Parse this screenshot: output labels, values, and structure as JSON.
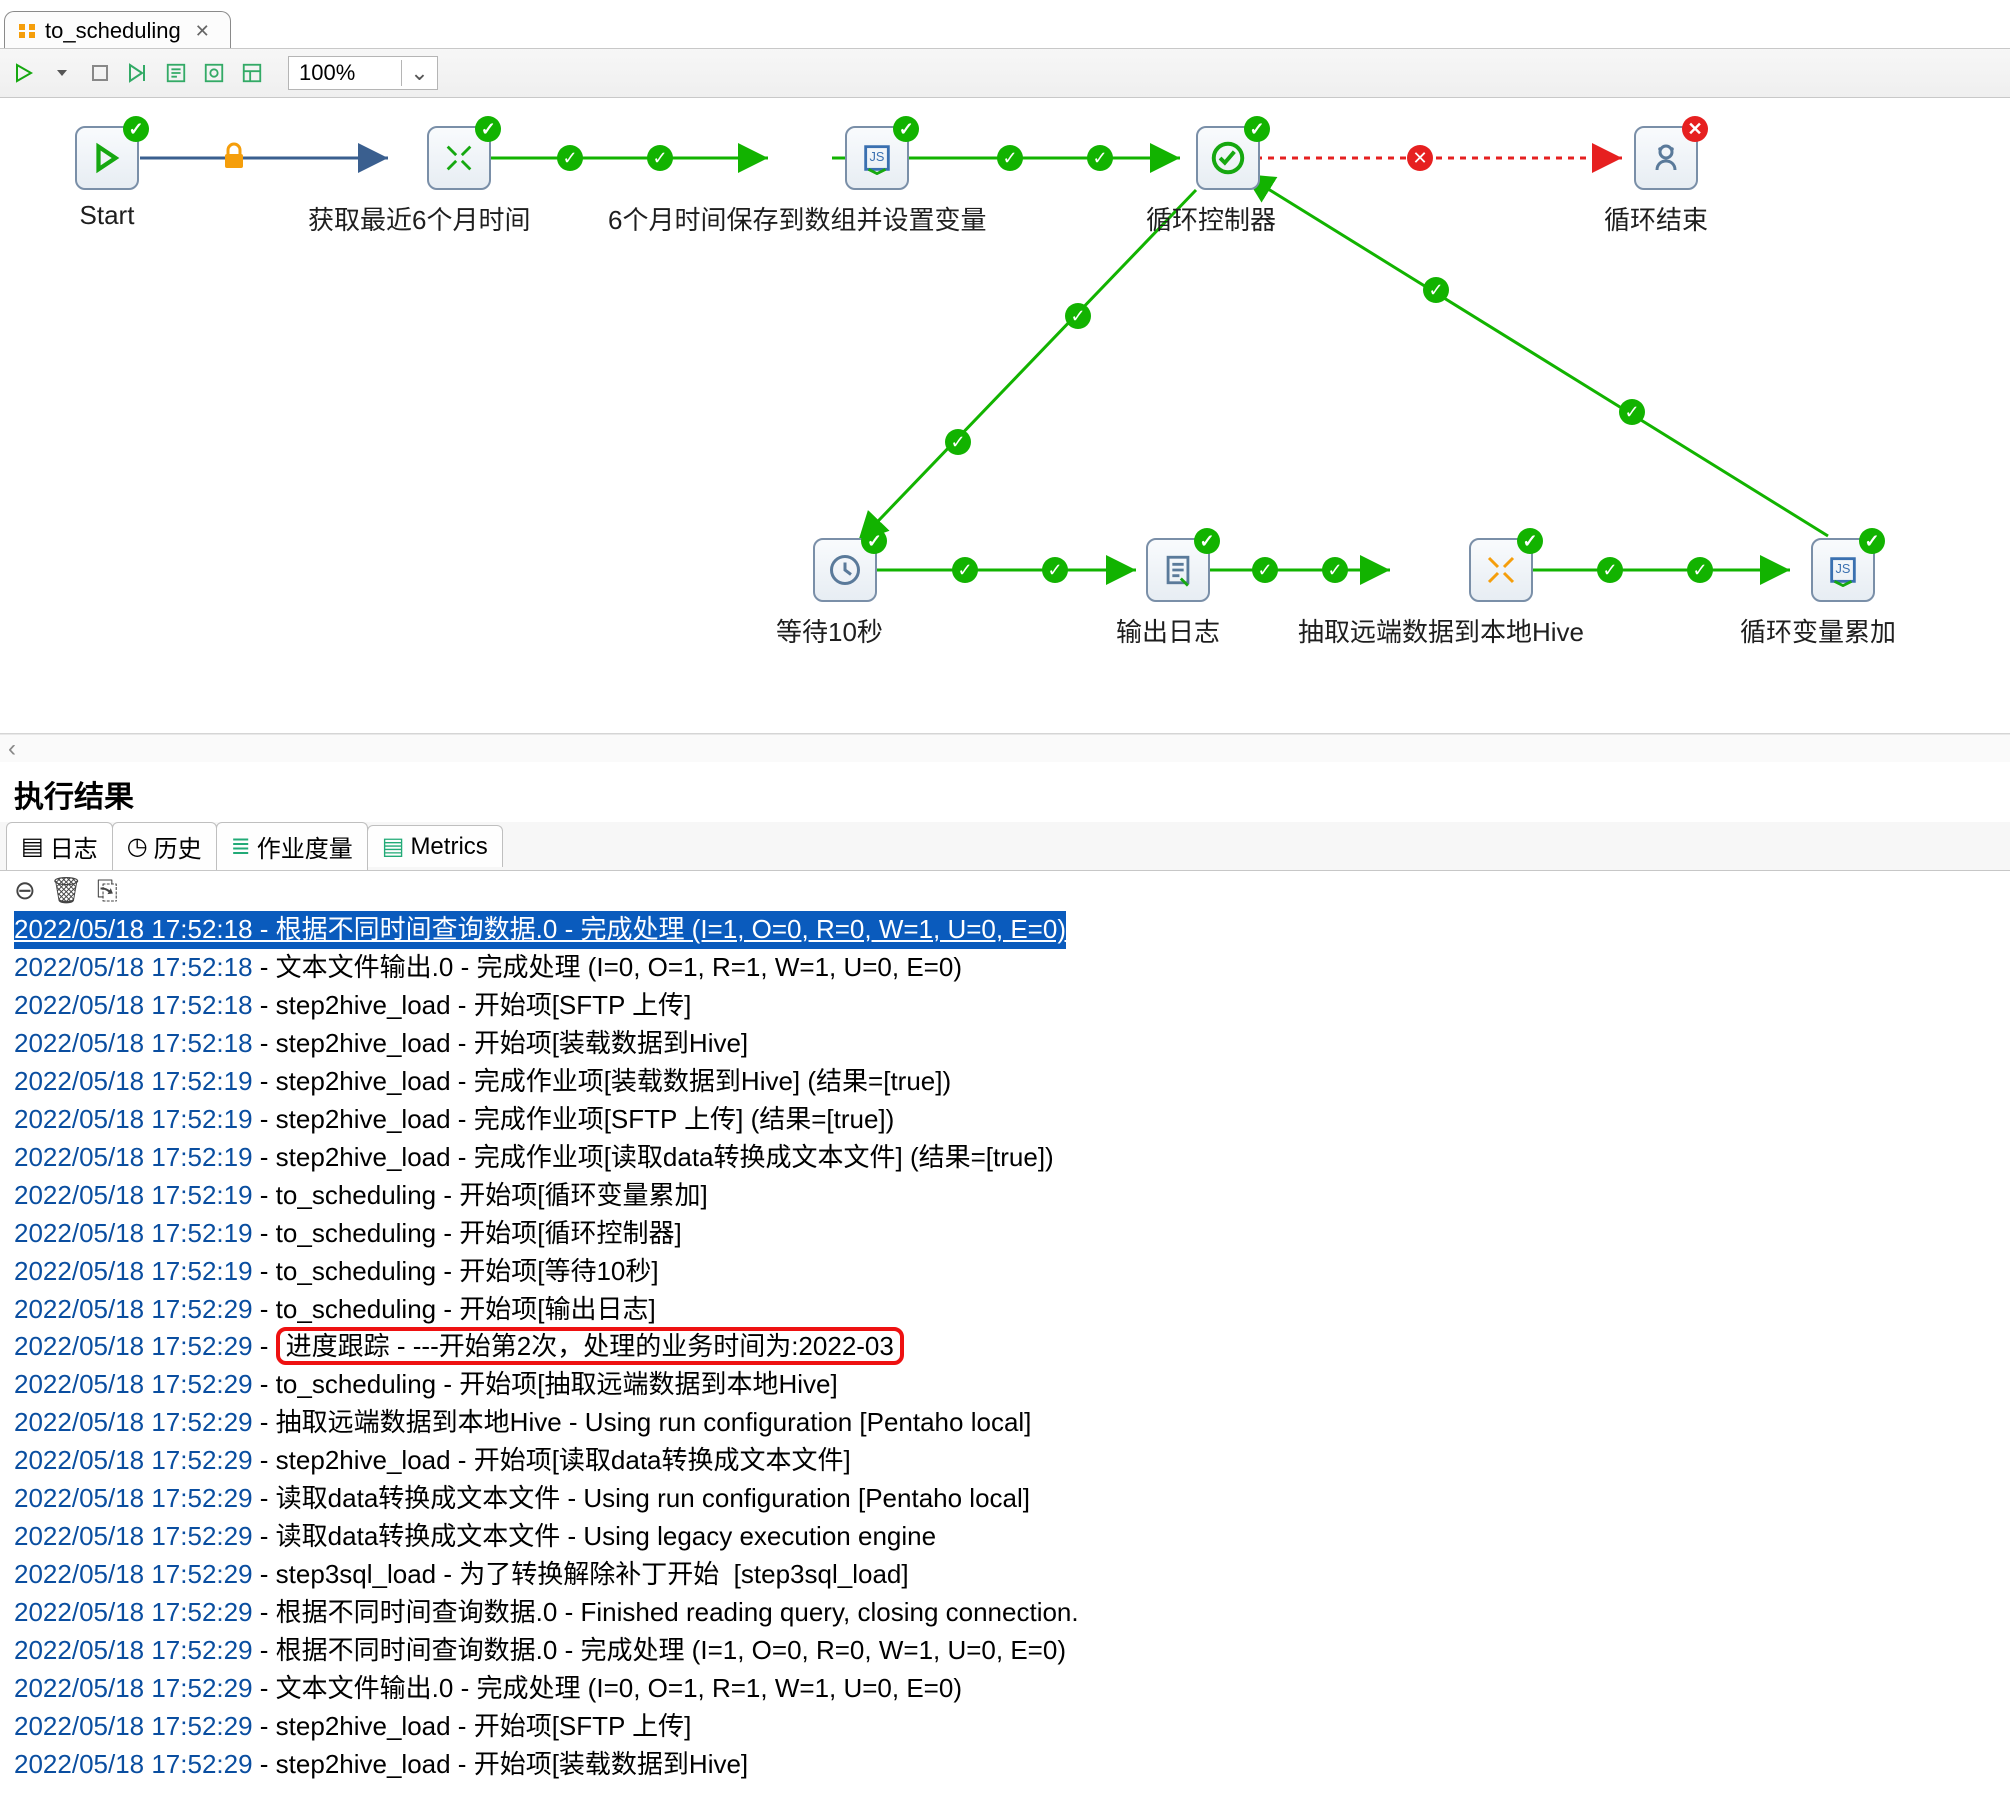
{
  "tab": {
    "title": "to_scheduling"
  },
  "toolbar": {
    "zoom": "100%"
  },
  "nodes": {
    "start": "Start",
    "n1": "获取最近6个月时间",
    "n2": "6个月时间保存到数组并设置变量",
    "n3": "循环控制器",
    "n4": "循环结束",
    "n5": "等待10秒",
    "n6": "输出日志",
    "n7": "抽取远端数据到本地Hive",
    "n8": "循环变量累加"
  },
  "results": {
    "title": "执行结果",
    "tabs": {
      "log": "日志",
      "history": "历史",
      "metrics_cn": "作业度量",
      "metrics": "Metrics"
    }
  },
  "log": [
    {
      "ts": "2022/05/18 17:52:18",
      "msg": "根据不同时间查询数据.0 - 完成处理 (I=1, O=0, R=0, W=1, U=0, E=0)",
      "sel": true
    },
    {
      "ts": "2022/05/18 17:52:18",
      "msg": "文本文件输出.0 - 完成处理 (I=0, O=1, R=1, W=1, U=0, E=0)"
    },
    {
      "ts": "2022/05/18 17:52:18",
      "msg": "step2hive_load - 开始项[SFTP 上传]"
    },
    {
      "ts": "2022/05/18 17:52:18",
      "msg": "step2hive_load - 开始项[装载数据到Hive]"
    },
    {
      "ts": "2022/05/18 17:52:19",
      "msg": "step2hive_load - 完成作业项[装载数据到Hive] (结果=[true])"
    },
    {
      "ts": "2022/05/18 17:52:19",
      "msg": "step2hive_load - 完成作业项[SFTP 上传] (结果=[true])"
    },
    {
      "ts": "2022/05/18 17:52:19",
      "msg": "step2hive_load - 完成作业项[读取data转换成文本文件] (结果=[true])"
    },
    {
      "ts": "2022/05/18 17:52:19",
      "msg": "to_scheduling - 开始项[循环变量累加]"
    },
    {
      "ts": "2022/05/18 17:52:19",
      "msg": "to_scheduling - 开始项[循环控制器]"
    },
    {
      "ts": "2022/05/18 17:52:19",
      "msg": "to_scheduling - 开始项[等待10秒]"
    },
    {
      "ts": "2022/05/18 17:52:29",
      "msg": "to_scheduling - 开始项[输出日志]"
    },
    {
      "ts": "2022/05/18 17:52:29",
      "msg": "进度跟踪 - ---开始第2次，处理的业务时间为:2022-03",
      "hl": true
    },
    {
      "ts": "2022/05/18 17:52:29",
      "msg": "to_scheduling - 开始项[抽取远端数据到本地Hive]"
    },
    {
      "ts": "2022/05/18 17:52:29",
      "msg": "抽取远端数据到本地Hive - Using run configuration [Pentaho local]"
    },
    {
      "ts": "2022/05/18 17:52:29",
      "msg": "step2hive_load - 开始项[读取data转换成文本文件]"
    },
    {
      "ts": "2022/05/18 17:52:29",
      "msg": "读取data转换成文本文件 - Using run configuration [Pentaho local]"
    },
    {
      "ts": "2022/05/18 17:52:29",
      "msg": "读取data转换成文本文件 - Using legacy execution engine"
    },
    {
      "ts": "2022/05/18 17:52:29",
      "msg": "step3sql_load - 为了转换解除补丁开始  [step3sql_load]"
    },
    {
      "ts": "2022/05/18 17:52:29",
      "msg": "根据不同时间查询数据.0 - Finished reading query, closing connection."
    },
    {
      "ts": "2022/05/18 17:52:29",
      "msg": "根据不同时间查询数据.0 - 完成处理 (I=1, O=0, R=0, W=1, U=0, E=0)"
    },
    {
      "ts": "2022/05/18 17:52:29",
      "msg": "文本文件输出.0 - 完成处理 (I=0, O=1, R=1, W=1, U=0, E=0)"
    },
    {
      "ts": "2022/05/18 17:52:29",
      "msg": "step2hive_load - 开始项[SFTP 上传]"
    },
    {
      "ts": "2022/05/18 17:52:29",
      "msg": "step2hive_load - 开始项[装载数据到Hive]"
    }
  ]
}
